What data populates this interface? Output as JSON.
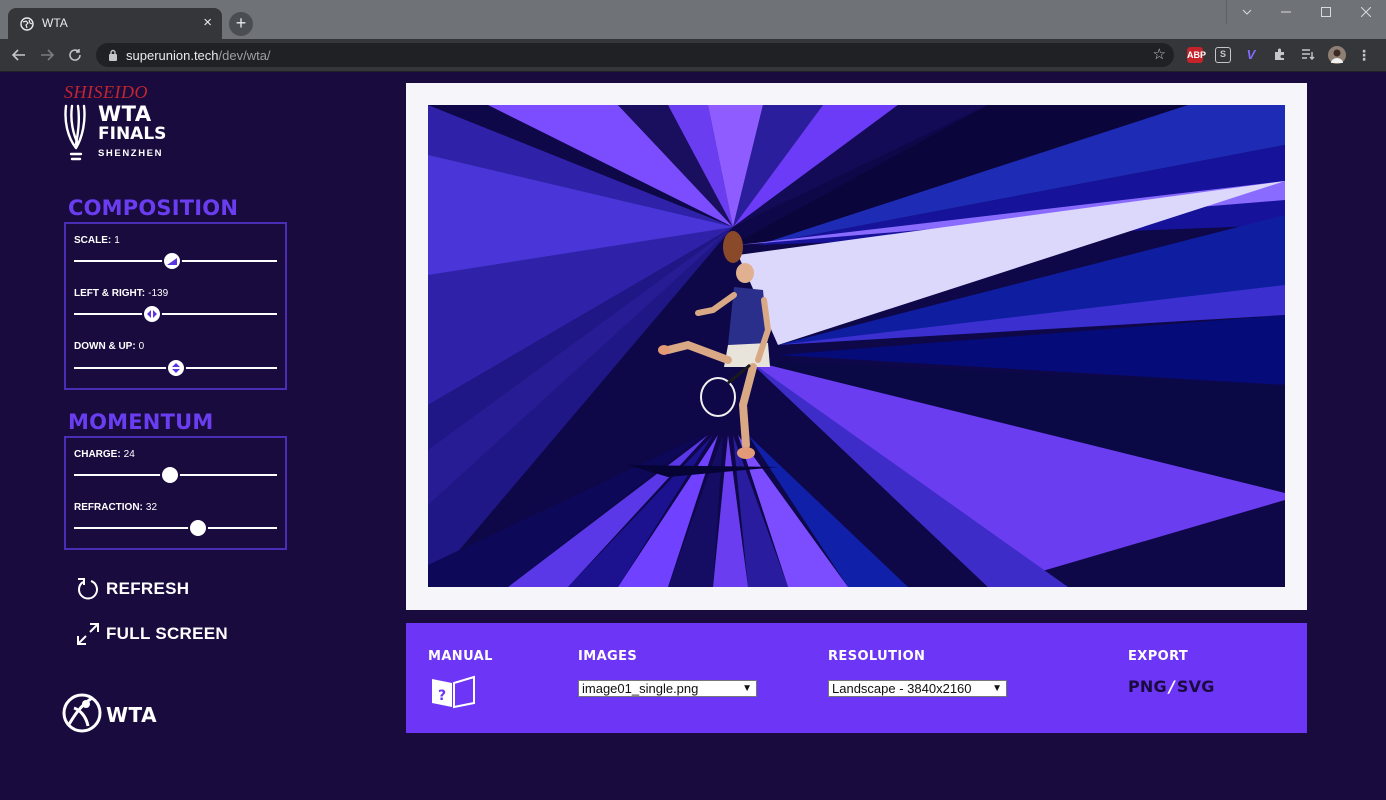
{
  "browser": {
    "tab_title": "WTA",
    "url_domain": "superunion.tech",
    "url_path": "/dev/wta/",
    "extensions": [
      "ABP",
      "S",
      "V"
    ]
  },
  "branding": {
    "sponsor": "SHISEIDO",
    "event_wta": "WTA",
    "event_finals": "FINALS",
    "event_city": "SHENZHEN",
    "footer_logo": "WTA"
  },
  "composition": {
    "title": "COMPOSITION",
    "scale": {
      "label": "SCALE:",
      "value": "1",
      "fraction": 0.5
    },
    "left_right": {
      "label": "LEFT & RIGHT:",
      "value": "-139",
      "fraction": 0.38
    },
    "down_up": {
      "label": "DOWN & UP:",
      "value": "0",
      "fraction": 0.5
    }
  },
  "momentum": {
    "title": "MOMENTUM",
    "charge": {
      "label": "CHARGE:",
      "value": "24",
      "fraction": 0.48
    },
    "refraction": {
      "label": "REFRACTION:",
      "value": "32",
      "fraction": 0.62
    }
  },
  "actions": {
    "refresh": "REFRESH",
    "full_screen": "FULL SCREEN"
  },
  "bottom_bar": {
    "manual_label": "MANUAL",
    "images_label": "IMAGES",
    "images_selected": "image01_single.png",
    "resolution_label": "RESOLUTION",
    "resolution_selected": "Landscape - 3840x2160",
    "export_label": "EXPORT",
    "export_png": "PNG",
    "export_separator": "/",
    "export_svg": "SVG"
  },
  "colors": {
    "page_bg": "#1a0b3f",
    "accent": "#6d35f5",
    "panel_border": "#4b2eb5",
    "section_title": "#6a3df0",
    "sponsor_red": "#c2262e"
  }
}
